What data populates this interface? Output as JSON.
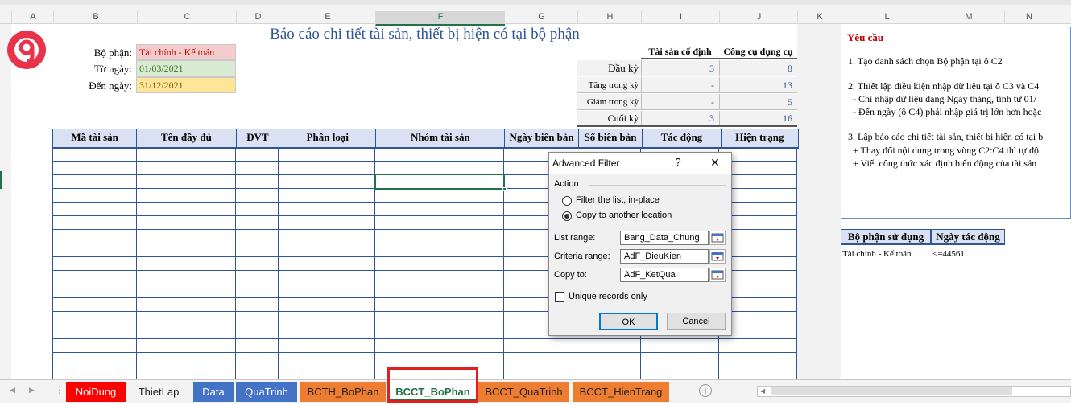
{
  "columns": [
    "A",
    "B",
    "C",
    "D",
    "E",
    "F",
    "G",
    "H",
    "I",
    "J",
    "K",
    "L",
    "M",
    "N"
  ],
  "report": {
    "title": "Báo cáo chi tiết tài sản, thiết bị hiện có tại bộ phận",
    "bo_phan_label": "Bộ phận:",
    "bo_phan_value": "Tài chính - Kế toán",
    "tu_ngay_label": "Từ ngày:",
    "tu_ngay_value": "01/03/2021",
    "den_ngay_label": "Đến ngày:",
    "den_ngay_value": "31/12/2021"
  },
  "summary": {
    "headers": [
      "Tài sản cố định",
      "Công cụ dụng cụ"
    ],
    "rows": [
      {
        "label": "Đầu kỳ",
        "a": "3",
        "b": "8"
      },
      {
        "label": "Tăng trong kỳ",
        "a": "-",
        "b": "13"
      },
      {
        "label": "Giảm trong kỳ",
        "a": "-",
        "b": "5"
      },
      {
        "label": "Cuối kỳ",
        "a": "3",
        "b": "16"
      }
    ]
  },
  "main_table": {
    "headers": [
      "Mã tài sản",
      "Tên đầy đủ",
      "ĐVT",
      "Phân loại",
      "Nhóm tài sản",
      "Ngày biên bản",
      "Số biên bản",
      "Tác động",
      "Hiện trạng"
    ]
  },
  "requirements": {
    "title": "Yêu cầu",
    "lines": [
      "1. Tạo danh sách chọn Bộ phận tại ô C2",
      "2. Thiết lập điều kiện nhập dữ liệu tại ô C3 và C4",
      "  - Chỉ nhập dữ liệu dạng Ngày tháng, tính từ 01/",
      "  - Đến ngày (ô C4) phải nhập giá trị lớn hơn hoặc",
      "3. Lập báo cáo chi tiết tài sản, thiết bị hiện có tại b",
      "  + Thay đổi nội dung trong vùng C2:C4 thì tự độ",
      "  + Viết công thức xác định biến động của tài sản"
    ]
  },
  "criteria": {
    "headers": [
      "Bộ phận sử dụng",
      "Ngày tác động"
    ],
    "values": [
      "Tài chính - Kế toán",
      "<=44561"
    ]
  },
  "dialog": {
    "title": "Advanced Filter",
    "help": "?",
    "close": "✕",
    "action_label": "Action",
    "radio1": "Filter the list, in-place",
    "radio2": "Copy to another location",
    "list_range_label": "List range:",
    "list_range_value": "Bang_Data_Chung",
    "criteria_range_label": "Criteria range:",
    "criteria_range_value": "AdF_DieuKien",
    "copy_to_label": "Copy to:",
    "copy_to_value": "AdF_KetQua",
    "unique_label": "Unique records only",
    "ok": "OK",
    "cancel": "Cancel"
  },
  "tabs": [
    {
      "label": "NoiDung",
      "color": "#ff0000"
    },
    {
      "label": "ThietLap",
      "color": "#f3f3f3"
    },
    {
      "label": "Data",
      "color": "#4472c4"
    },
    {
      "label": "QuaTrinh",
      "color": "#4472c4"
    },
    {
      "label": "BCTH_BoPhan",
      "color": "#ed7d31"
    },
    {
      "label": "BCCT_BoPhan",
      "color": "#ffffff"
    },
    {
      "label": "BCCT_QuaTrinh",
      "color": "#ed7d31"
    },
    {
      "label": "BCCT_HienTrang",
      "color": "#ed7d31"
    }
  ],
  "tabbar_icons": {
    "prev": "◀",
    "next": "▶",
    "add": "+",
    "more": "⋮"
  }
}
